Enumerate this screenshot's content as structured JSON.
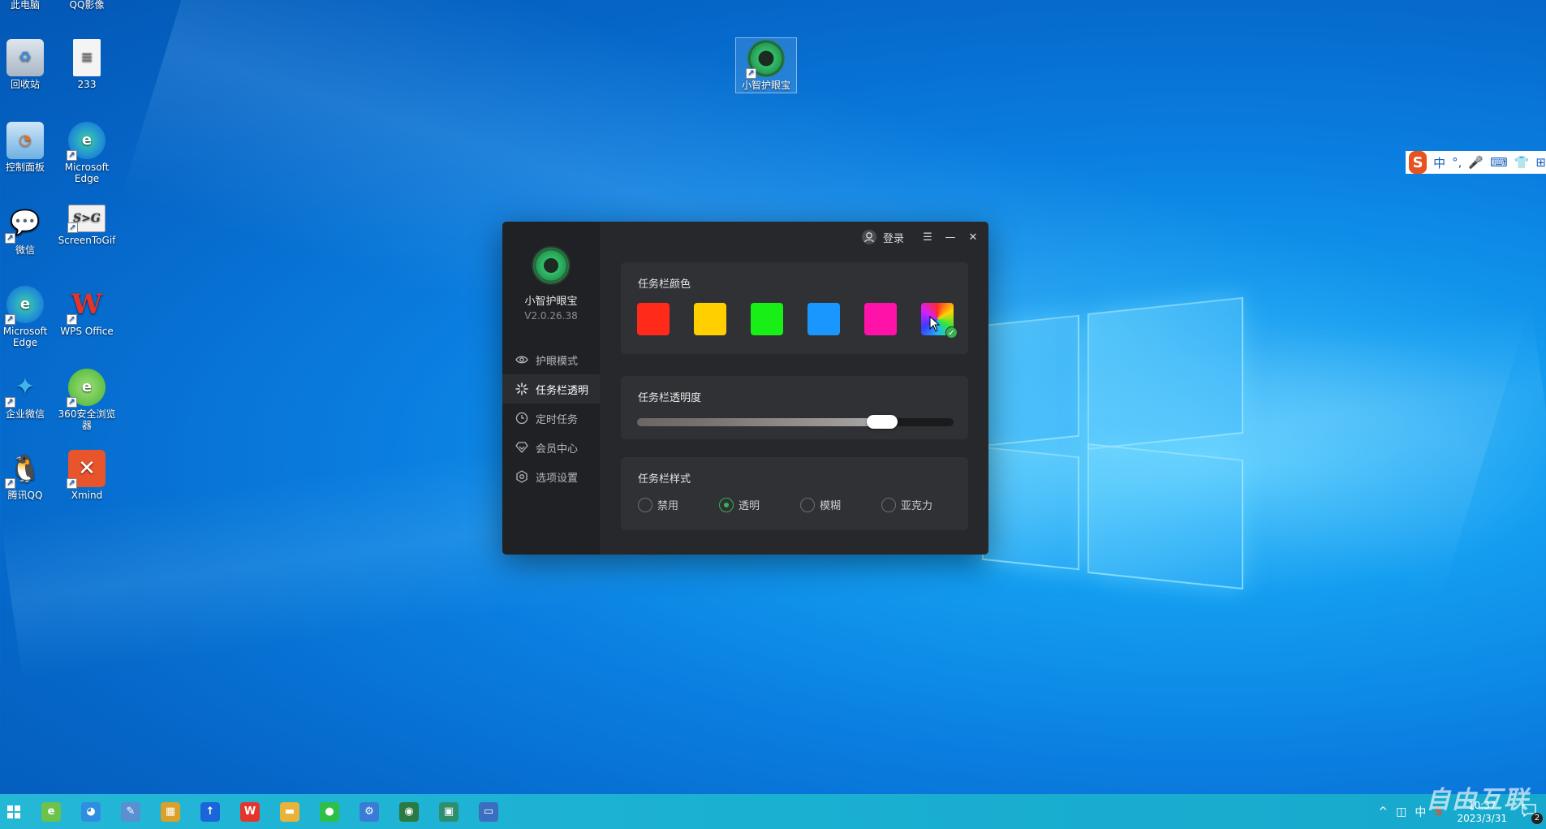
{
  "desktop": {
    "icons": [
      {
        "label": "此电脑",
        "symbol": "🖥"
      },
      {
        "label": "QQ影像",
        "symbol": "Q"
      },
      {
        "label": "回收站",
        "symbol": "♻"
      },
      {
        "label": "233",
        "symbol": "≡"
      },
      {
        "label": "控制面板",
        "symbol": "◔"
      },
      {
        "label": "Microsoft Edge",
        "symbol": "e"
      },
      {
        "label": "微信",
        "symbol": "💬"
      },
      {
        "label": "ScreenToGif",
        "symbol": "S>G"
      },
      {
        "label": "Microsoft Edge",
        "symbol": "e"
      },
      {
        "label": "WPS Office",
        "symbol": "W"
      },
      {
        "label": "企业微信",
        "symbol": "✦"
      },
      {
        "label": "360安全浏览器",
        "symbol": "e"
      },
      {
        "label": "腾讯QQ",
        "symbol": "🐧"
      },
      {
        "label": "Xmind",
        "symbol": "✕"
      },
      {
        "label": "小智护眼宝",
        "symbol": "◉"
      }
    ],
    "shortcut_mark": "↗"
  },
  "ime": {
    "logo": "S",
    "items": [
      "中",
      "°,",
      "🎤",
      "⌨",
      "👕",
      "⊞"
    ]
  },
  "app": {
    "name": "小智护眼宝",
    "version": "V2.0.26.38",
    "login_label": "登录",
    "menu_symbol": "☰",
    "minimize_symbol": "—",
    "close_symbol": "✕",
    "nav": [
      {
        "label": "护眼模式",
        "icon": "eye-icon",
        "active": false
      },
      {
        "label": "任务栏透明",
        "icon": "sparkle-icon",
        "active": true
      },
      {
        "label": "定时任务",
        "icon": "clock-icon",
        "active": false
      },
      {
        "label": "会员中心",
        "icon": "diamond-icon",
        "active": false
      },
      {
        "label": "选项设置",
        "icon": "settings-icon",
        "active": false
      }
    ],
    "color_card": {
      "title": "任务栏颜色",
      "swatches": [
        "#ff2a1a",
        "#ffcf00",
        "#17ef17",
        "#1a96ff",
        "#ff12a7",
        "rainbow"
      ],
      "selected_index": 5
    },
    "opacity_card": {
      "title": "任务栏透明度",
      "value_percent": 80
    },
    "style_card": {
      "title": "任务栏样式",
      "options": [
        "禁用",
        "透明",
        "模糊",
        "亚克力"
      ],
      "selected_index": 1
    }
  },
  "taskbar": {
    "apps": [
      {
        "name": "360-icon",
        "symbol": "e",
        "color": "#6cc24a"
      },
      {
        "name": "browser-icon",
        "symbol": "◕",
        "color": "#2f8ee0"
      },
      {
        "name": "notepad-icon",
        "symbol": "✎",
        "color": "#5a8fd1"
      },
      {
        "name": "screentogif-icon",
        "symbol": "▦",
        "color": "#d9a12a"
      },
      {
        "name": "feishu-icon",
        "symbol": "↑",
        "color": "#1a66d8"
      },
      {
        "name": "wps-icon",
        "symbol": "W",
        "color": "#e4352c"
      },
      {
        "name": "folder-icon",
        "symbol": "▬",
        "color": "#e9b33a"
      },
      {
        "name": "wechat-icon",
        "symbol": "●",
        "color": "#2dbf46"
      },
      {
        "name": "settings-icon",
        "symbol": "⚙",
        "color": "#3a7bd5"
      },
      {
        "name": "eyecare-icon",
        "symbol": "◉",
        "color": "#2a7a44"
      },
      {
        "name": "image-icon",
        "symbol": "▣",
        "color": "#2e8f6f"
      },
      {
        "name": "presentation-icon",
        "symbol": "▭",
        "color": "#3a6fc0"
      }
    ],
    "tray_symbols": [
      "^",
      "◫",
      "中",
      "S"
    ],
    "time": "10:37",
    "date": "2023/3/31",
    "notification_count": "2"
  },
  "watermark": "自由互联"
}
